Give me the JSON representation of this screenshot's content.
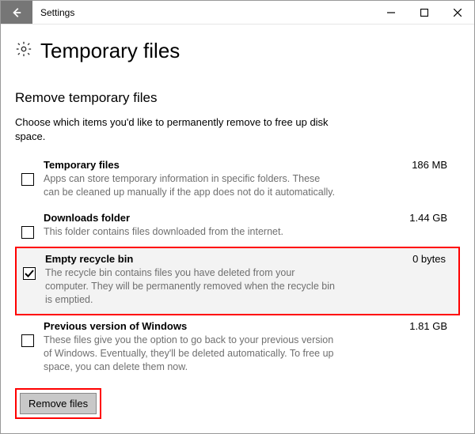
{
  "window": {
    "title": "Settings"
  },
  "page": {
    "title": "Temporary files",
    "subheading": "Remove temporary files",
    "intro": "Choose which items you'd like to permanently remove to free up disk space."
  },
  "items": [
    {
      "title": "Temporary files",
      "size": "186 MB",
      "desc": "Apps can store temporary information in specific folders. These can be cleaned up manually if the app does not do it automatically.",
      "checked": false,
      "highlight": false
    },
    {
      "title": "Downloads folder",
      "size": "1.44 GB",
      "desc": "This folder contains files downloaded from the internet.",
      "checked": false,
      "highlight": false
    },
    {
      "title": "Empty recycle bin",
      "size": "0 bytes",
      "desc": "The recycle bin contains files you have deleted from your computer. They will be permanently removed when the recycle bin is emptied.",
      "checked": true,
      "highlight": true
    },
    {
      "title": "Previous version of Windows",
      "size": "1.81 GB",
      "desc": "These files give you the option to go back to your previous version of Windows. Eventually, they'll be deleted automatically. To free up space, you can delete them now.",
      "checked": false,
      "highlight": false
    }
  ],
  "actions": {
    "remove_label": "Remove files"
  }
}
